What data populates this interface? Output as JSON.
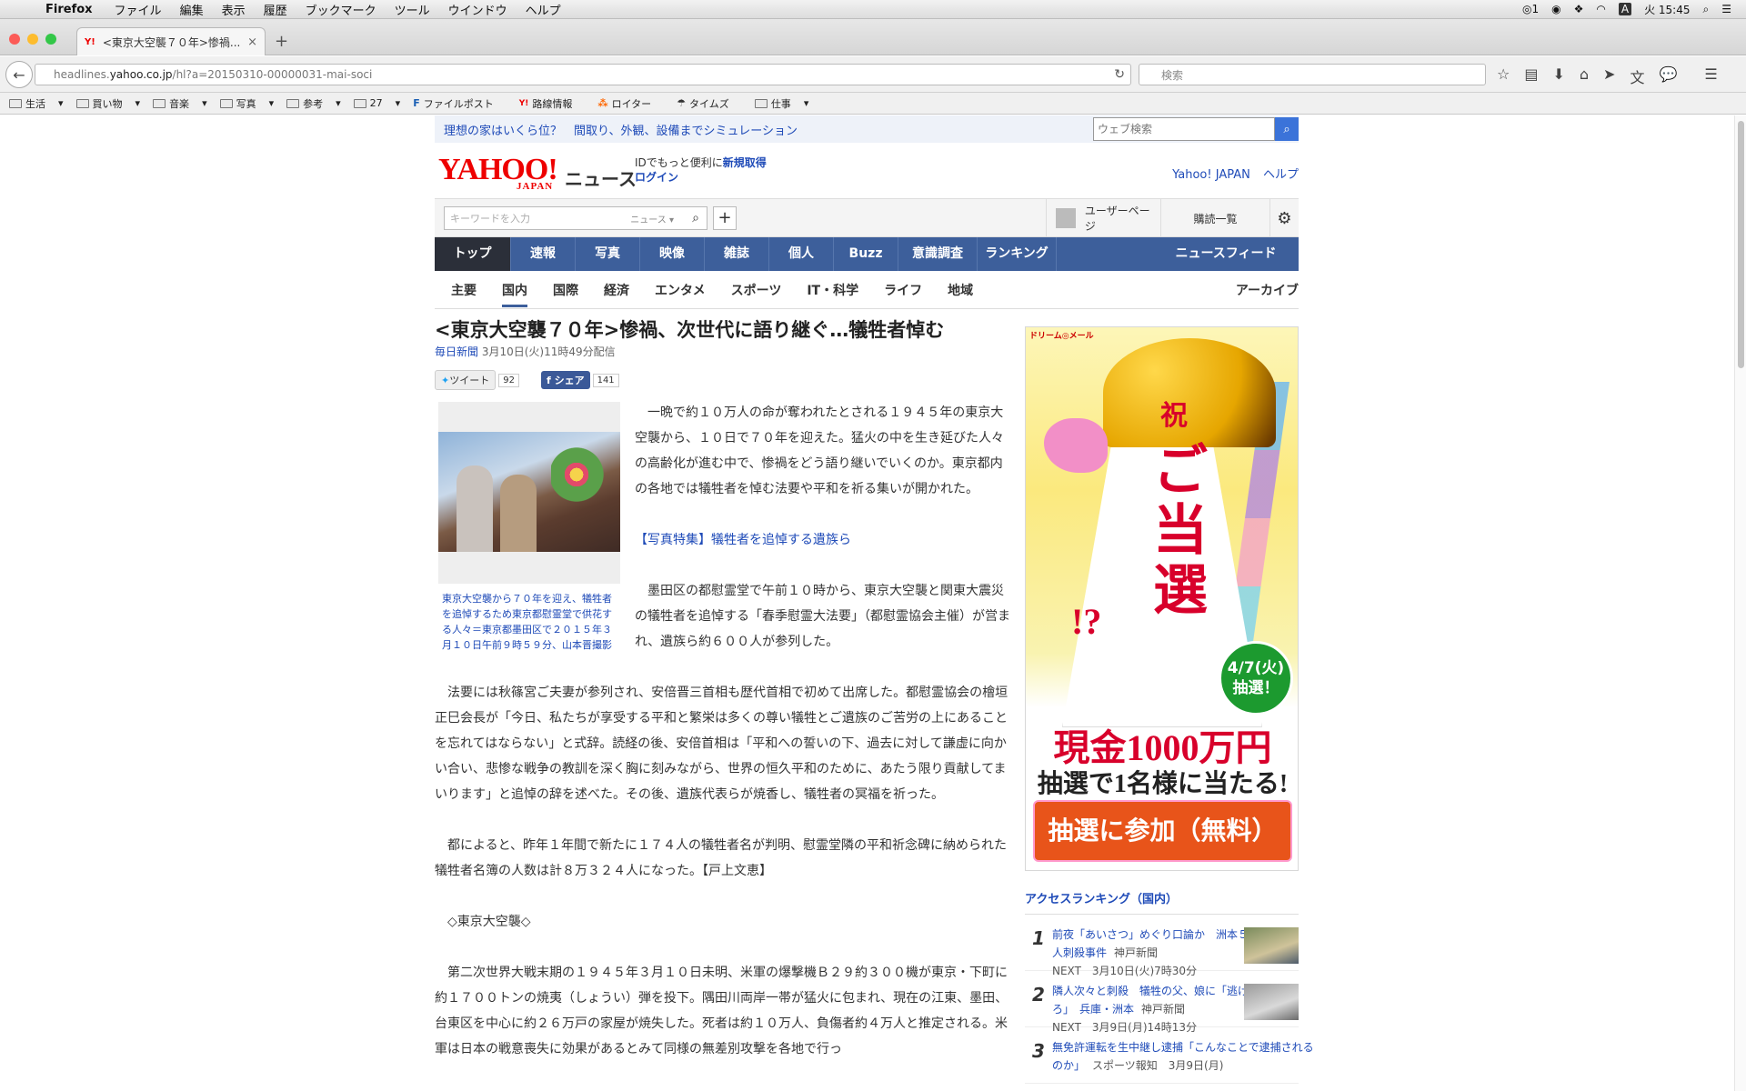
{
  "os_menu": {
    "app": "Firefox",
    "items": [
      "ファイル",
      "編集",
      "表示",
      "履歴",
      "ブックマーク",
      "ツール",
      "ウインドウ",
      "ヘルプ"
    ],
    "badge": "1",
    "input": "A",
    "clock": "火 15:45"
  },
  "browser": {
    "tab_title": "<東京大空襲７０年>惨禍...",
    "url_host": "headlines.",
    "url_domain": "yahoo.co.jp",
    "url_path": "/hl?a=20150310-00000031-mai-soci",
    "search_placeholder": "検索",
    "bookmarks": [
      "生活",
      "買い物",
      "音楽",
      "写真",
      "参考",
      "27",
      "ファイルポスト",
      "路線情報",
      "ロイター",
      "タイムズ",
      "仕事"
    ]
  },
  "promo": {
    "text": "理想の家はいくら位？　間取り、外観、設備までシミュレーション",
    "web_search_placeholder": "ウェブ検索"
  },
  "header": {
    "logo": "YAHOO!",
    "logo_sub": "JAPAN",
    "section": "ニュース",
    "id_text": "IDでもっと便利に",
    "signup": "新規取得",
    "login": "ログイン",
    "links": [
      "Yahoo! JAPAN",
      "ヘルプ"
    ]
  },
  "toolbar": {
    "keyword_placeholder": "キーワードを入力",
    "scope": "ニュース",
    "user_page": "ユーザーページ",
    "subscriptions": "購読一覧"
  },
  "global_nav": [
    "トップ",
    "速報",
    "写真",
    "映像",
    "雑誌",
    "個人",
    "Buzz",
    "意識調査",
    "ランキング",
    "ニュースフィード"
  ],
  "sub_nav": [
    "主要",
    "国内",
    "国際",
    "経済",
    "エンタメ",
    "スポーツ",
    "IT・科学",
    "ライフ",
    "地域"
  ],
  "sub_nav_archive": "アーカイブ",
  "article": {
    "title": "<東京大空襲７０年>惨禍、次世代に語り継ぐ…犠牲者悼む",
    "source": "毎日新聞",
    "date": "3月10日(火)11時49分配信",
    "tweet_label": "ツイート",
    "tweet_count": "92",
    "share_label": "シェア",
    "share_count": "141",
    "caption": "東京大空襲から７０年を迎え、犠牲者を追悼するため東京都慰霊堂で供花する人々＝東京都墨田区で２０１５年３月１０日午前９時５９分、山本晋撮影",
    "p1": "　一晩で約１０万人の命が奪われたとされる１９４５年の東京大空襲から、１０日で７０年を迎えた。猛火の中を生き延びた人々の高齢化が進む中で、惨禍をどう語り継いでいくのか。東京都内の各地では犠牲者を悼む法要や平和を祈る集いが開かれた。",
    "photo_link": "【写真特集】犠牲者を追悼する遺族ら",
    "p2": "　墨田区の都慰霊堂で午前１０時から、東京大空襲と関東大震災の犠牲者を追悼する「春季慰霊大法要」（都慰霊協会主催）が営まれ、遺族ら約６００人が参列した。",
    "p3": "　法要には秋篠宮ご夫妻が参列され、安倍晋三首相も歴代首相で初めて出席した。都慰霊協会の檜垣正巳会長が「今日、私たちが享受する平和と繁栄は多くの尊い犠牲とご遺族のご苦労の上にあることを忘れてはならない」と式辞。読経の後、安倍首相は「平和への誓いの下、過去に対して謙虚に向かい合い、悲惨な戦争の教訓を深く胸に刻みながら、世界の恒久平和のために、あたう限り貢献してまいります」と追悼の辞を述べた。その後、遺族代表らが焼香し、犠牲者の冥福を祈った。",
    "p4": "　都によると、昨年１年間で新たに１７４人の犠牲者名が判明、慰霊堂隣の平和祈念碑に納められた犠牲者名簿の人数は計８万３２４人になった。【戸上文恵】",
    "p5": "　◇東京大空襲◇",
    "p6": "　第二次世界大戦末期の１９４５年３月１０日未明、米軍の爆撃機Ｂ２９約３００機が東京・下町に約１７００トンの焼夷（しょうい）弾を投下。隅田川両岸一帯が猛火に包まれ、現在の江東、墨田、台東区を中心に約２６万戸の家屋が焼失した。死者は約１０万人、負傷者約４万人と推定される。米軍は日本の戦意喪失に効果があるとみて同様の無差別攻撃を各地で行っ"
  },
  "ad": {
    "brand": "ドリーム◎メール",
    "iwai": "祝",
    "main": "ご当選",
    "q": "!?",
    "date": "4/7(火)抽選！",
    "prize": "現金1000万円",
    "once": "抽選で1名様に当たる!",
    "cta": "抽選に参加（無料）"
  },
  "ranking": {
    "heading": "アクセスランキング（国内）",
    "items": [
      {
        "rank": "1",
        "title": "前夜「あいさつ」めぐり口論か　洲本５人刺殺事件",
        "source": "神戸新聞",
        "next": "NEXT　3月10日(火)7時30分"
      },
      {
        "rank": "2",
        "title": "隣人次々と刺殺　犠牲の父、娘に「逃げろ」　兵庫・洲本",
        "source": "神戸新聞",
        "next": "NEXT　3月9日(月)14時13分"
      },
      {
        "rank": "3",
        "title": "無免許運転を生中継し逮捕「こんなことで逮捕されるのか」",
        "source": "スポーツ報知　3月9日(月)",
        "next": ""
      }
    ]
  }
}
